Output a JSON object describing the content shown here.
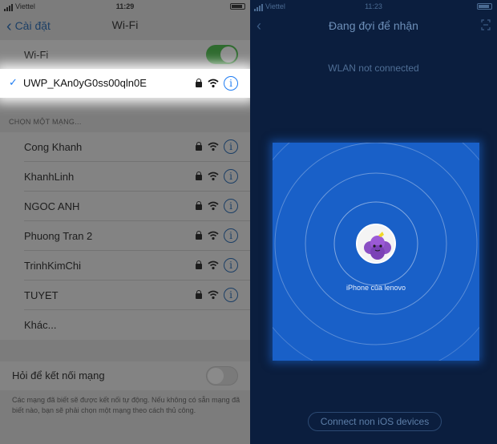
{
  "left": {
    "status": {
      "carrier": "Viettel",
      "time": "11:29"
    },
    "nav": {
      "back_label": "Cài đặt",
      "title": "Wi-Fi"
    },
    "wifi_toggle": {
      "label": "Wi-Fi",
      "on": true
    },
    "connected_network": {
      "name": "UWP_KAn0yG0ss00qln0E",
      "check": "✓"
    },
    "section_header": "CHỌN MỘT MẠNG...",
    "networks": [
      {
        "name": "Cong Khanh"
      },
      {
        "name": "KhanhLinh"
      },
      {
        "name": "NGOC ANH"
      },
      {
        "name": "Phuong Tran 2"
      },
      {
        "name": "TrinhKimChi"
      },
      {
        "name": "TUYET"
      }
    ],
    "other_label": "Khác...",
    "ask_to_join": {
      "label": "Hỏi để kết nối mạng",
      "on": false
    },
    "footnote": "Các mạng đã biết sẽ được kết nối tự động. Nếu không có sẵn mạng đã biết nào, bạn sẽ phải chọn một mạng theo cách thủ công."
  },
  "right": {
    "status": {
      "carrier": "Viettel",
      "time": "11:23"
    },
    "title": "Đang đợi để nhận",
    "wlan_status": "WLAN not connected",
    "device_name": "iPhone của lenovo",
    "connect_button": "Connect non iOS devices",
    "accent_color": "#1960c8"
  },
  "icons": {
    "info": "i",
    "back_chevron": "‹"
  }
}
